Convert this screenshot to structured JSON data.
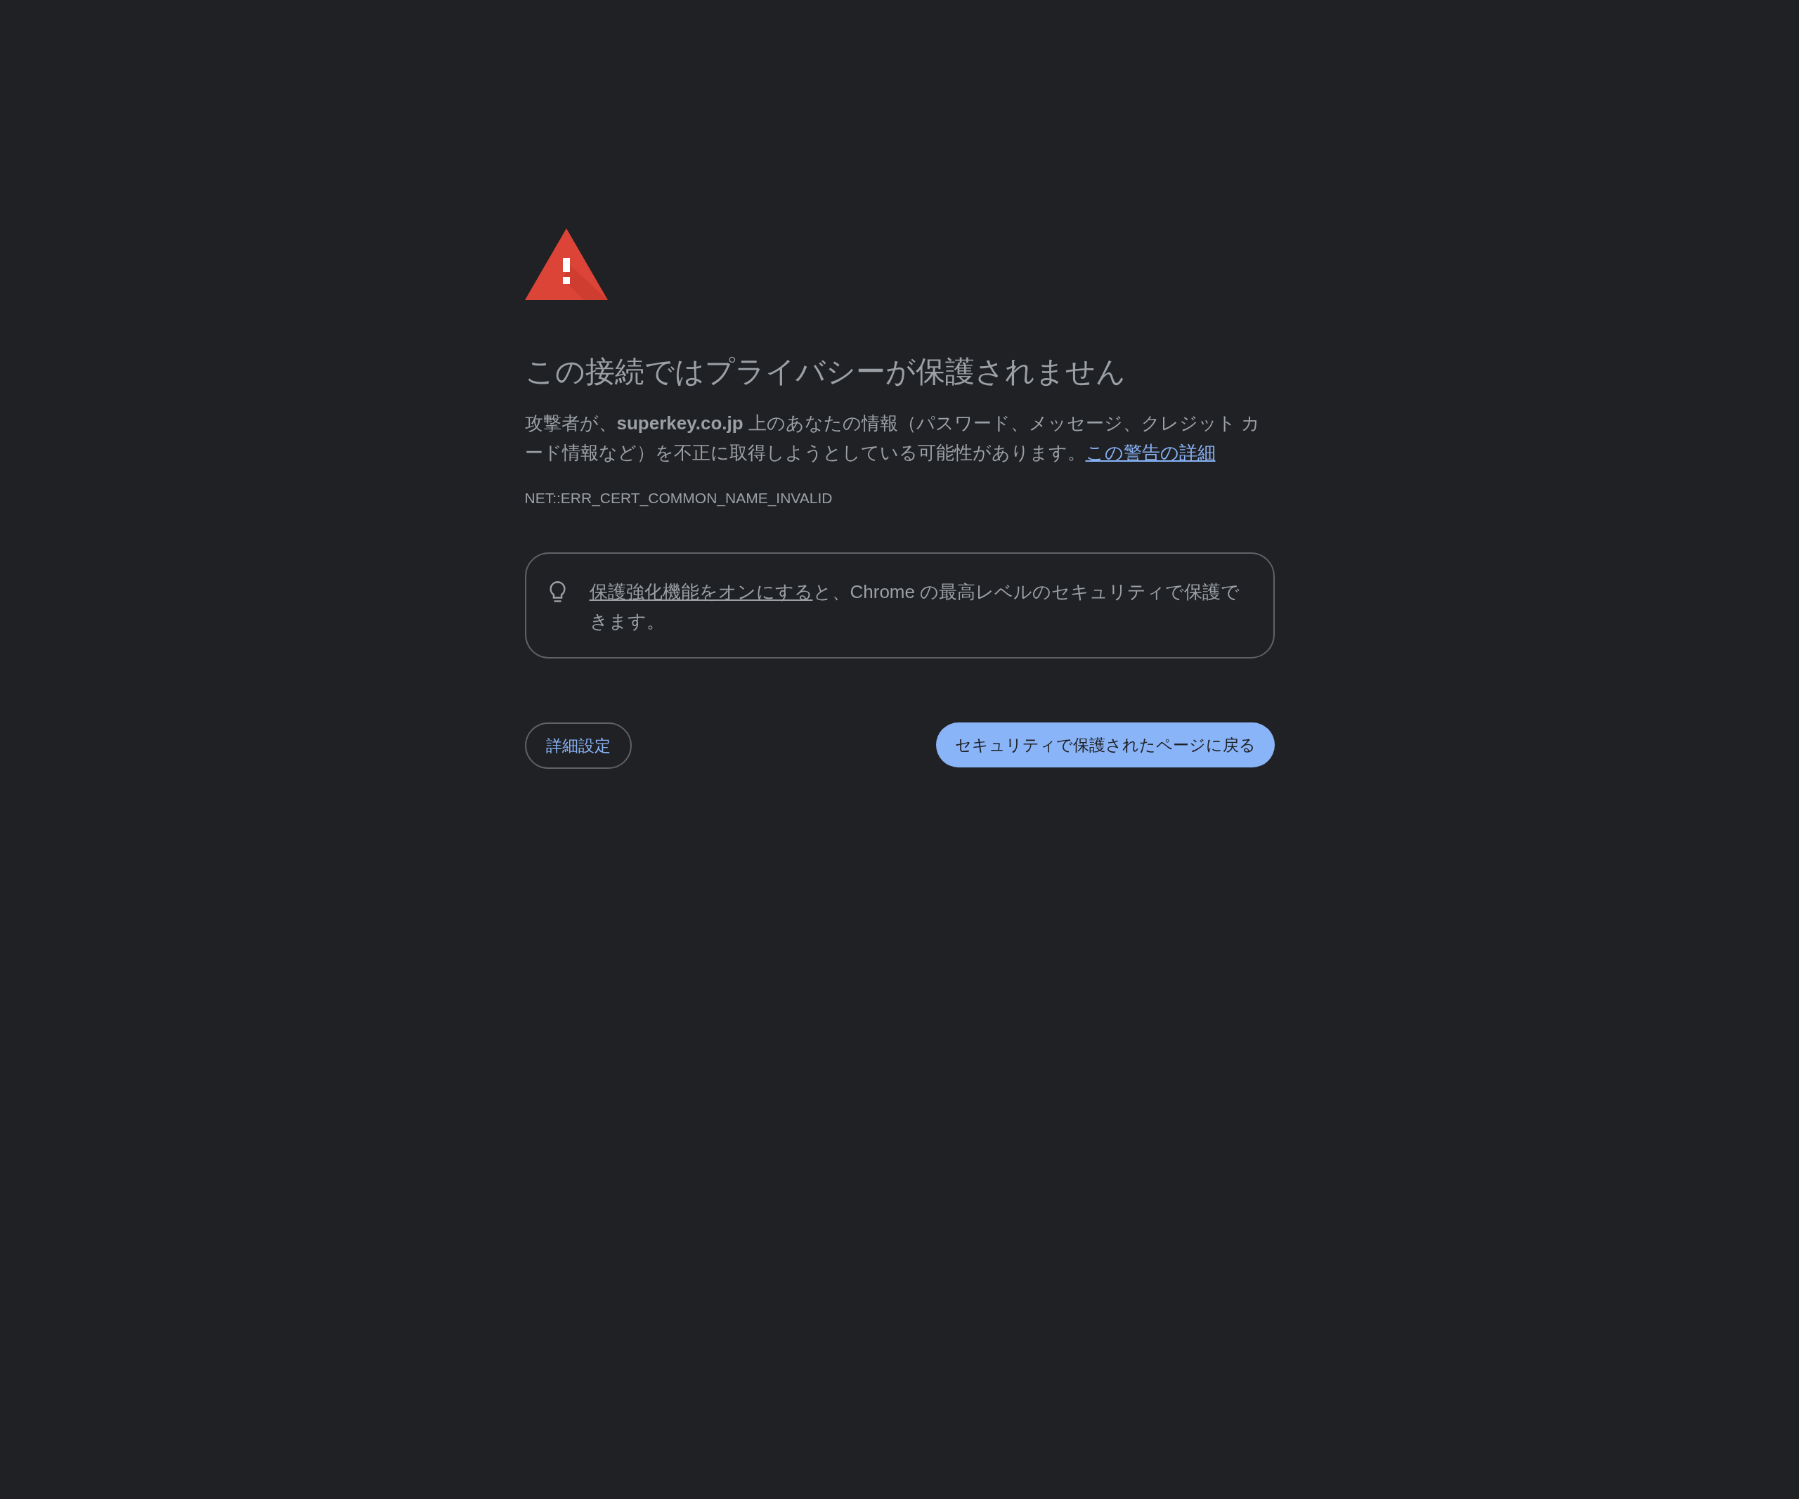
{
  "heading": "この接続ではプライバシーが保護されません",
  "message": {
    "text": "攻撃者が、**superkey.co.jp** 上のあなたの情報（パスワード、メッセージ、クレジット カード情報など）を不正に取得しようとしている可能性があります。",
    "link": "この警告の詳細"
  },
  "error_code": "NET::ERR_CERT_COMMON_NAME_INVALID",
  "tip": {
    "link": "保護強化機能をオンにする",
    "text": "と、Chrome の最高レベルのセキュリティで保護できます。"
  },
  "buttons": [
    {
      "label": "詳細設定",
      "kind": "secondary"
    },
    {
      "label": "セキュリティで保護されたページに戻る",
      "kind": "primary"
    }
  ]
}
